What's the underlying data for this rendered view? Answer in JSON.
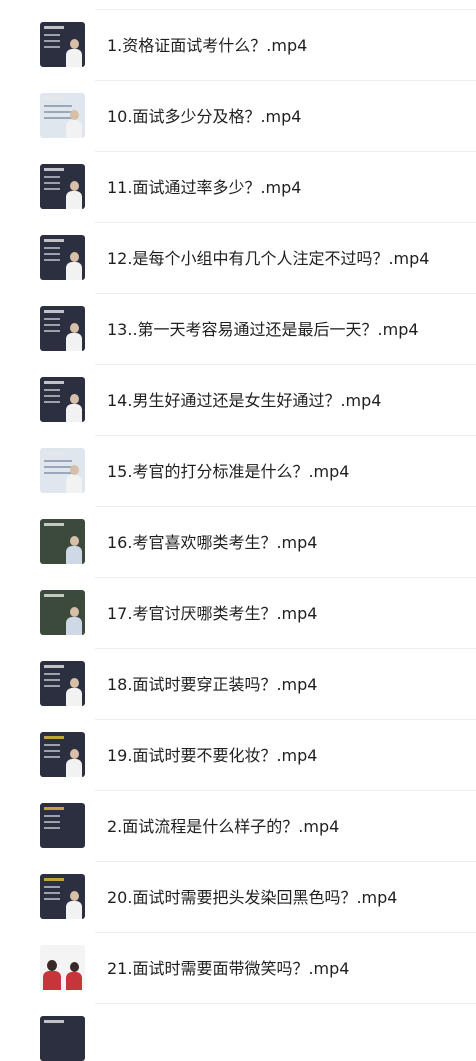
{
  "files": [
    {
      "label": "1.资格证面试考什么？.mp4",
      "thumb": "dark"
    },
    {
      "label": "10.面试多少分及格？.mp4",
      "thumb": "light"
    },
    {
      "label": "11.面试通过率多少？.mp4",
      "thumb": "dark"
    },
    {
      "label": "12.是每个小组中有几个人注定不过吗？.mp4",
      "thumb": "dark"
    },
    {
      "label": "13..第一天考容易通过还是最后一天？.mp4",
      "thumb": "dark"
    },
    {
      "label": "14.男生好通过还是女生好通过？.mp4",
      "thumb": "dark"
    },
    {
      "label": "15.考官的打分标准是什么？.mp4",
      "thumb": "light"
    },
    {
      "label": "16.考官喜欢哪类考生？.mp4",
      "thumb": "photo"
    },
    {
      "label": "17.考官讨厌哪类考生？.mp4",
      "thumb": "photo"
    },
    {
      "label": "18.面试时要穿正装吗？.mp4",
      "thumb": "dark"
    },
    {
      "label": "19.面试时要不要化妆？.mp4",
      "thumb": "gold"
    },
    {
      "label": "2.面试流程是什么样子的？.mp4",
      "thumb": "gold"
    },
    {
      "label": "20.面试时需要把头发染回黑色吗？.mp4",
      "thumb": "gold"
    },
    {
      "label": "21.面试时需要面带微笑吗？.mp4",
      "thumb": "red"
    }
  ]
}
